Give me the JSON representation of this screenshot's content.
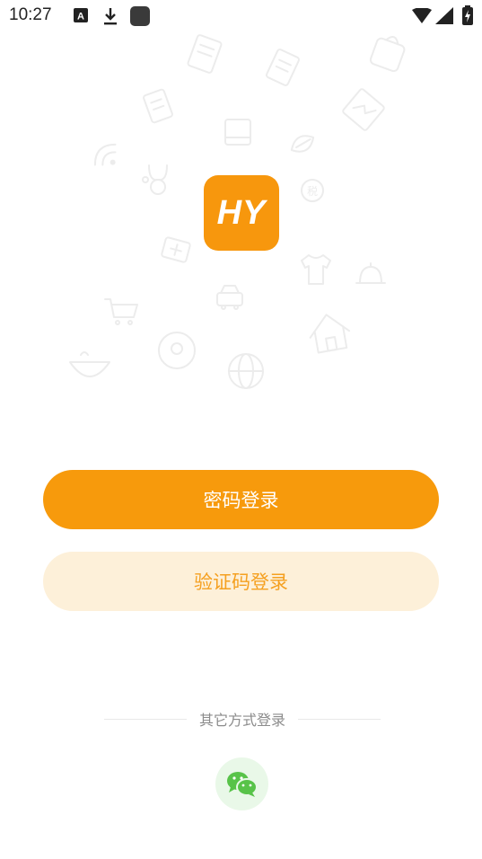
{
  "status_bar": {
    "time": "10:27",
    "icons": [
      "a-notification-icon",
      "download-icon",
      "app-notification-icon",
      "wifi-icon",
      "signal-icon",
      "battery-charging-icon"
    ]
  },
  "logo": {
    "text": "HY",
    "color": "#f7970d"
  },
  "buttons": {
    "password_login": "密码登录",
    "code_login": "验证码登录"
  },
  "other_login": {
    "label": "其它方式登录",
    "wechat_icon": "wechat-icon"
  },
  "colors": {
    "accent": "#f79a0c",
    "accent_light": "#fdf0d9",
    "accent_text": "#f5a020",
    "wechat_green": "#58c349"
  }
}
